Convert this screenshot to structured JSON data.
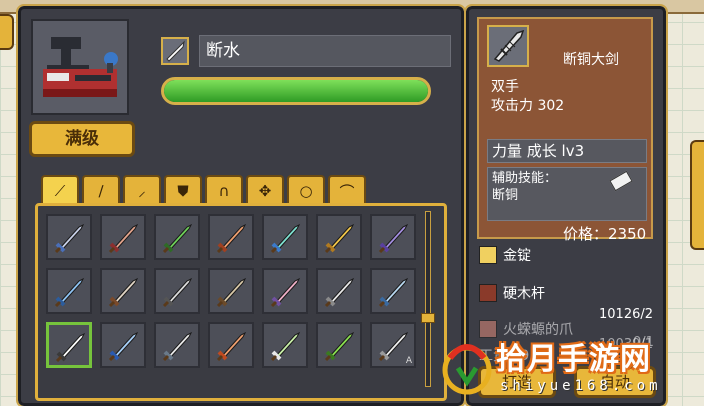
{
  "item": {
    "name": "断水",
    "durability_fraction": 1.0,
    "max_level_label": "满级"
  },
  "tabs": [
    {
      "icon": "sword-icon",
      "glyph": "⟋",
      "active": true
    },
    {
      "icon": "staff-icon",
      "glyph": "∕",
      "active": false
    },
    {
      "icon": "axe-icon",
      "glyph": "⸝",
      "active": false
    },
    {
      "icon": "shield-icon",
      "glyph": "⛊",
      "active": false
    },
    {
      "icon": "helmet-icon",
      "glyph": "∩",
      "active": false
    },
    {
      "icon": "armor-icon",
      "glyph": "✥",
      "active": false
    },
    {
      "icon": "ring-icon",
      "glyph": "○",
      "active": false
    },
    {
      "icon": "bow-icon",
      "glyph": "⌒",
      "active": false
    }
  ],
  "weapons": [
    {
      "name": "weapon-1",
      "blade": "#c8d0e8",
      "hilt": "#4a6fb8"
    },
    {
      "name": "weapon-2",
      "blade": "#e2a38c",
      "hilt": "#8c2f2f"
    },
    {
      "name": "weapon-3",
      "blade": "#6ed05a",
      "hilt": "#2e6b26"
    },
    {
      "name": "weapon-4",
      "blade": "#f0a070",
      "hilt": "#a04020"
    },
    {
      "name": "weapon-5",
      "blade": "#7ee0d0",
      "hilt": "#3b7acb"
    },
    {
      "name": "weapon-6",
      "blade": "#f4c84a",
      "hilt": "#b07a20"
    },
    {
      "name": "weapon-7",
      "blade": "#a48ee0",
      "hilt": "#5a40a0"
    },
    {
      "name": "weapon-8",
      "blade": "#8fc4f4",
      "hilt": "#2c5c9c"
    },
    {
      "name": "weapon-9",
      "blade": "#e0d4c4",
      "hilt": "#7a4a2a"
    },
    {
      "name": "weapon-10",
      "blade": "#dcdcdc",
      "hilt": "#555555"
    },
    {
      "name": "weapon-11",
      "blade": "#d8c8a8",
      "hilt": "#6a4a2a"
    },
    {
      "name": "weapon-12",
      "blade": "#f0b0c8",
      "hilt": "#7050a0"
    },
    {
      "name": "weapon-13",
      "blade": "#e8e8e8",
      "hilt": "#8a8a8a"
    },
    {
      "name": "weapon-14",
      "blade": "#b8d8f0",
      "hilt": "#3a6aa0"
    },
    {
      "name": "weapon-15",
      "blade": "#ffffff",
      "hilt": "#3a3a3a",
      "selected": true
    },
    {
      "name": "weapon-16",
      "blade": "#a8d0f8",
      "hilt": "#2a5ab0"
    },
    {
      "name": "weapon-17",
      "blade": "#e8e8e8",
      "hilt": "#6a7a8a"
    },
    {
      "name": "weapon-18",
      "blade": "#f0a070",
      "hilt": "#c04a20"
    },
    {
      "name": "weapon-19",
      "blade": "#c8f0a8",
      "hilt": "#e8e8e8"
    },
    {
      "name": "weapon-20",
      "blade": "#8ae050",
      "hilt": "#3a7a20"
    },
    {
      "name": "weapon-21",
      "blade": "#f0f0f0",
      "hilt": "#9a9a9a",
      "tag": "A"
    }
  ],
  "detail": {
    "name": "断铜大剑",
    "type": "双手",
    "attack": "攻击力 302",
    "growth": "力量 成长 lv3",
    "skill_label": "辅助技能：",
    "skill_value": "断铜",
    "price": "价格：2350"
  },
  "materials": [
    {
      "name": "金锭",
      "icon": "gold-ingot-icon",
      "color": "#f0d060",
      "count": "",
      "dim": false
    },
    {
      "name": "硬木杆",
      "icon": "hardwood-rod-icon",
      "color": "#8a3a2a",
      "count": "10126/2",
      "dim": false
    },
    {
      "name": "火蝾螈的爪",
      "icon": "salamander-claw-icon",
      "color": "#e08a7a",
      "count": "10039/1",
      "dim": true
    },
    {
      "name": "工资 99",
      "icon": "",
      "color": "",
      "count": "0/1",
      "dim": true
    }
  ],
  "actions": {
    "forge": "打造",
    "auto": "自动"
  },
  "watermark": {
    "text": "拾月手游网",
    "url": "shiyue168.com"
  }
}
